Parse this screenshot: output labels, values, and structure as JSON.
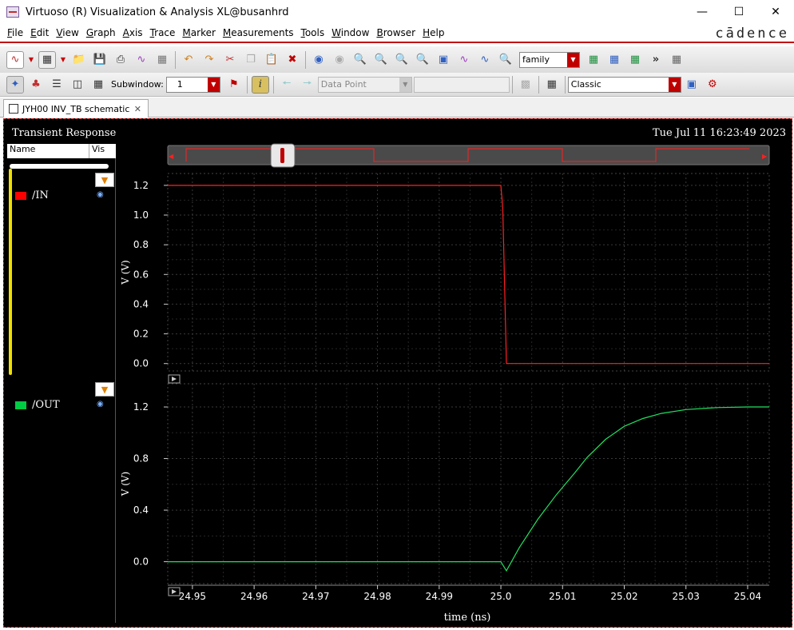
{
  "window": {
    "title": "Virtuoso (R) Visualization & Analysis XL@busanhrd",
    "brand": "cādence"
  },
  "menu": [
    "File",
    "Edit",
    "View",
    "Graph",
    "Axis",
    "Trace",
    "Marker",
    "Measurements",
    "Tools",
    "Window",
    "Browser",
    "Help"
  ],
  "toolbar1": {
    "family_combo": "family"
  },
  "toolbar2": {
    "subwindow_label": "Subwindow:",
    "subwindow_value": "1",
    "datapoint_value": "Data Point",
    "style_value": "Classic"
  },
  "tabs": [
    {
      "label": "JYH00 INV_TB schematic"
    }
  ],
  "plot_window": {
    "title": "Transient Response",
    "date": "Tue Jul 11 16:23:49 2023   1"
  },
  "legend": {
    "col_name": "Name",
    "col_vis": "Vis",
    "traces": [
      {
        "name": "/IN",
        "color": "#ff0000"
      },
      {
        "name": "/OUT",
        "color": "#00cc44"
      }
    ]
  },
  "chart_data": [
    {
      "type": "line",
      "title": "",
      "xlabel": "time (ns)",
      "ylabel": "V (V)",
      "xlim": [
        24.946,
        25.0435
      ],
      "ylim": [
        -0.05,
        1.28
      ],
      "yticks": [
        0.0,
        0.2,
        0.4,
        0.6,
        0.8,
        1.0,
        1.2
      ],
      "ytick_labels": [
        "0.0",
        "0.2",
        "0.4",
        "0.6",
        "0.8",
        "1.0",
        "1.2"
      ],
      "series": [
        {
          "name": "/IN",
          "color": "#ff2020",
          "x": [
            24.946,
            25.0,
            25.0003,
            25.0009,
            25.0435
          ],
          "y": [
            1.2,
            1.2,
            1.05,
            0.0,
            0.0
          ]
        }
      ]
    },
    {
      "type": "line",
      "title": "",
      "xlabel": "time (ns)",
      "ylabel": "V (V)",
      "xlim": [
        24.946,
        25.0435
      ],
      "ylim": [
        -0.17,
        1.38
      ],
      "yticks": [
        0.0,
        0.4,
        0.8,
        1.2
      ],
      "ytick_labels": [
        "0.0",
        "0.4",
        "0.8",
        "1.2"
      ],
      "xticks": [
        24.95,
        24.96,
        24.97,
        24.98,
        24.99,
        25.0,
        25.01,
        25.02,
        25.03,
        25.04
      ],
      "xtick_labels": [
        "24.95",
        "24.96",
        "24.97",
        "24.98",
        "24.99",
        "25.0",
        "25.01",
        "25.02",
        "25.03",
        "25.04"
      ],
      "series": [
        {
          "name": "/OUT",
          "color": "#20e060",
          "x": [
            24.946,
            25.0,
            25.0009,
            25.003,
            25.006,
            25.009,
            25.012,
            25.014,
            25.017,
            25.02,
            25.023,
            25.026,
            25.03,
            25.035,
            25.04,
            25.0435
          ],
          "y": [
            0.0,
            0.0,
            -0.07,
            0.11,
            0.33,
            0.52,
            0.69,
            0.81,
            0.95,
            1.05,
            1.11,
            1.15,
            1.18,
            1.195,
            1.2,
            1.2
          ]
        }
      ]
    }
  ]
}
